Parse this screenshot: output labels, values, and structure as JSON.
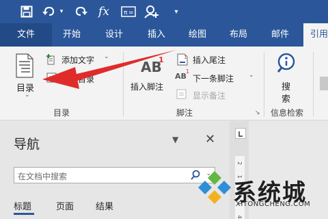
{
  "tabs": {
    "file": "文件",
    "home": "开始",
    "design": "设计",
    "insert": "插入",
    "draw": "绘图",
    "layout": "布局",
    "mailings": "邮件",
    "references": "引用"
  },
  "ribbon": {
    "toc_label": "目录",
    "add_text": "添加文字",
    "update_toc": "更新目录",
    "toc_group": "目录",
    "insert_footnote": "插入脚注",
    "insert_endnote": "插入尾注",
    "next_footnote": "下一条脚注",
    "show_notes": "显示备注",
    "footnote_group": "脚注",
    "search_label_1": "搜",
    "search_label_2": "索",
    "research_group": "信息检索",
    "ab_text": "AB",
    "ab_sup": "1",
    "ab_small": "AB"
  },
  "qat": {
    "fx": "fx"
  },
  "nav_pane": {
    "title": "导航",
    "search_placeholder": "在文档中搜索",
    "tabs": [
      "标题",
      "页面",
      "结果"
    ]
  },
  "ruler": {
    "marks": "2 1 2 1 4"
  },
  "watermark": {
    "name": "系统城",
    "url": "XITONGCHENG.COM"
  },
  "colors": {
    "ribbon_blue": "#2b579a",
    "arrow_red": "#e02b2b"
  }
}
